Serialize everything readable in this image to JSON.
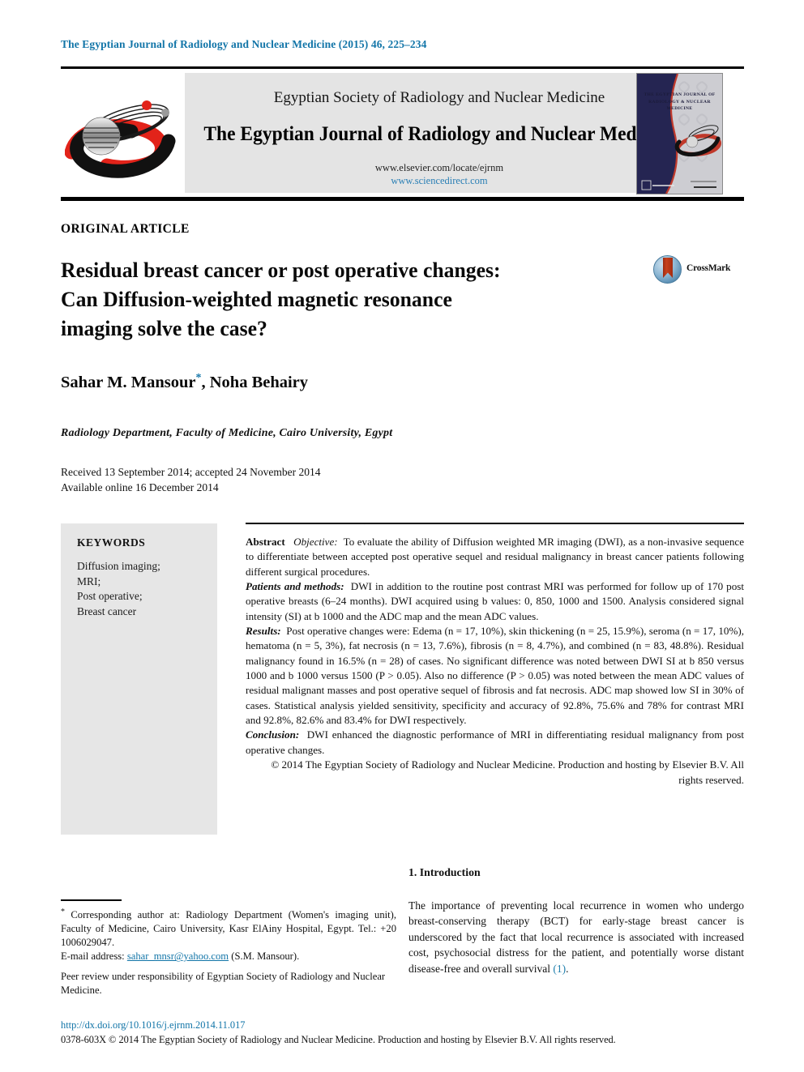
{
  "running_head": "The Egyptian Journal of Radiology and Nuclear Medicine (2015) 46, 225–234",
  "masthead": {
    "society": "Egyptian Society of Radiology and Nuclear Medicine",
    "journal_title": "The Egyptian Journal of Radiology and Nuclear Medicine",
    "url_elsevier": "www.elsevier.com/locate/ejrnm",
    "url_sciencedirect": "www.sciencedirect.com",
    "cover_caption": "THE EGYPTIAN JOURNAL OF RADIOLOGY & NUCLEAR MEDICINE",
    "society_logo_name": "egyptian-society-radiology-logo",
    "cover_name": "journal-cover-thumbnail"
  },
  "article": {
    "type": "ORIGINAL ARTICLE",
    "title_line1": "Residual breast cancer or post operative changes:",
    "title_line2": "Can Diffusion-weighted magnetic resonance",
    "title_line3": "imaging solve the case?",
    "crossmark_label": "CrossMark",
    "authors": "Sahar M. Mansour",
    "authors_star": "*",
    "authors_rest": ", Noha Behairy",
    "affiliation": "Radiology Department, Faculty of Medicine, Cairo University, Egypt",
    "received": "Received 13 September 2014; accepted 24 November 2014",
    "available": "Available online 16 December 2014"
  },
  "keywords": {
    "heading": "KEYWORDS",
    "items": [
      "Diffusion imaging;",
      "MRI;",
      "Post operative;",
      "Breast cancer"
    ]
  },
  "abstract": {
    "label": "Abstract",
    "objective_label": "Objective:",
    "objective_text": "To evaluate the ability of Diffusion weighted MR imaging (DWI), as a non-invasive sequence to differentiate between accepted post operative sequel and residual malignancy in breast cancer patients following different surgical procedures.",
    "methods_label": "Patients and methods:",
    "methods_text": "DWI in addition to the routine post contrast MRI was performed for follow up of 170 post operative breasts (6–24 months). DWI acquired using b values: 0, 850, 1000 and 1500. Analysis considered signal intensity (SI) at b 1000 and the ADC map and the mean ADC values.",
    "results_label": "Results:",
    "results_text": "Post operative changes were: Edema (n = 17, 10%), skin thickening (n = 25, 15.9%), seroma (n = 17, 10%), hematoma (n = 5, 3%), fat necrosis (n = 13, 7.6%), fibrosis (n = 8, 4.7%), and combined (n = 83, 48.8%). Residual malignancy found in 16.5% (n = 28) of cases. No significant difference was noted between DWI SI at b 850 versus 1000 and b 1000 versus 1500 (P > 0.05). Also no difference (P > 0.05) was noted between the mean ADC values of residual malignant masses and post operative sequel of fibrosis and fat necrosis. ADC map showed low SI in 30% of cases. Statistical analysis yielded sensitivity, specificity and accuracy of 92.8%, 75.6% and 78% for contrast MRI and 92.8%, 82.6% and 83.4% for DWI respectively.",
    "conclusion_label": "Conclusion:",
    "conclusion_text": "DWI enhanced the diagnostic performance of MRI in differentiating residual malignancy from post operative changes.",
    "copyright": "© 2014 The Egyptian Society of Radiology and Nuclear Medicine. Production and hosting by Elsevier B.V. All rights reserved."
  },
  "introduction": {
    "heading": "1. Introduction",
    "body_before_ref": "The importance of preventing local recurrence in women who undergo breast-conserving therapy (BCT) for early-stage breast cancer is underscored by the fact that local recurrence is associated with increased cost, psychosocial distress for the patient, and potentially worse distant disease-free and overall survival ",
    "reference": "(1)",
    "body_after_ref": "."
  },
  "footnotes": {
    "star": "*",
    "corresponding": "Corresponding author at: Radiology Department (Women's imaging unit), Faculty of Medicine, Cairo University, Kasr ElAiny Hospital, Egypt. Tel.: +20 1006029047.",
    "email_label": "E-mail address:",
    "email": "sahar_mnsr@yahoo.com",
    "email_suffix": "(S.M. Mansour).",
    "peer_review": "Peer review under responsibility of Egyptian Society of Radiology and Nuclear Medicine."
  },
  "bottom": {
    "doi": "http://dx.doi.org/10.1016/j.ejrnm.2014.11.017",
    "copyright_line": "0378-603X © 2014 The Egyptian Society of Radiology and Nuclear Medicine. Production and hosting by Elsevier B.V. All rights reserved."
  },
  "colors": {
    "link_blue": "#1275a8",
    "ref_blue": "#1f7fad",
    "masthead_grey": "#e4e4e4",
    "keywords_grey": "#e6e6e6",
    "logo_red": "#e2231a",
    "cover_navy": "#252552"
  }
}
